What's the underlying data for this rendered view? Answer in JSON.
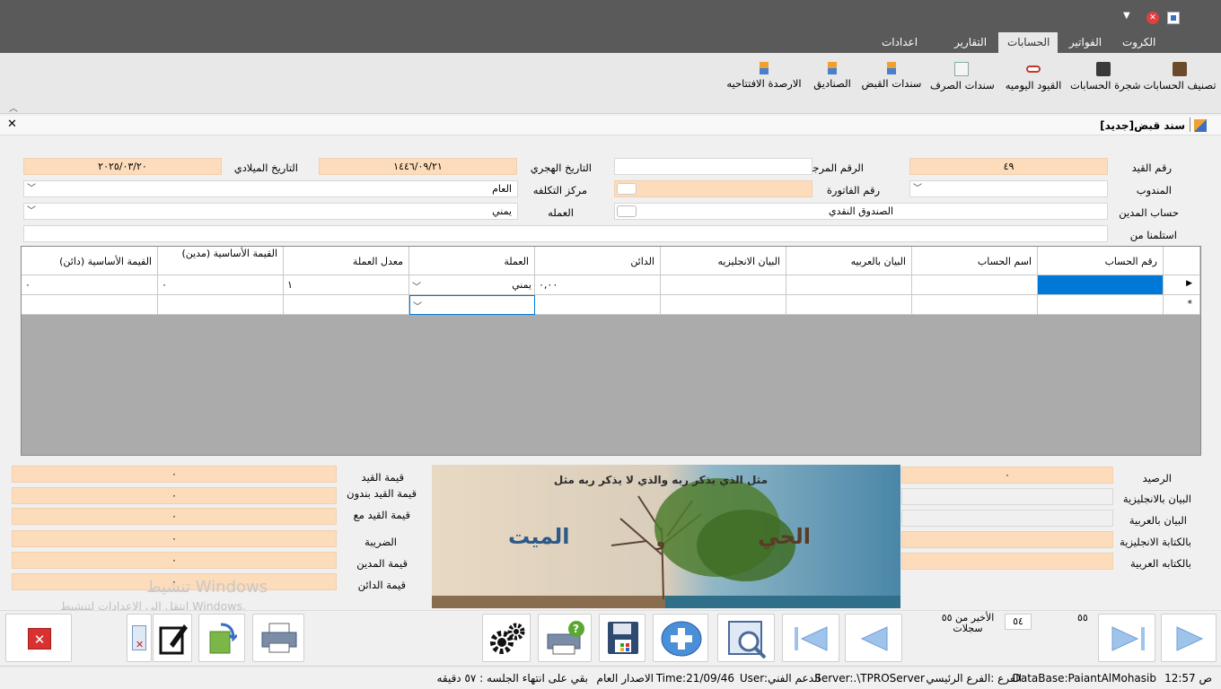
{
  "ribbon_tabs": [
    "الكروت",
    "الفواتير",
    "الحسابات",
    "التقارير",
    "اعدادات النظام"
  ],
  "ribbon_buttons": [
    "تصنيف الحسابات",
    "شجرة الحسابات",
    "القيود اليوميه",
    "سندات الصرف",
    "سندات القبض",
    "الصناديق",
    "الارصدة الافتتاحيه"
  ],
  "child_title": "سند قبض[جديد]",
  "form": {
    "entry_no_label": "رقم القيد",
    "entry_no": "٤٩",
    "ref_no_label": "الرقم المرجعي",
    "ref_no": "",
    "hijri_label": "التاريخ الهجري",
    "hijri": "١٤٤٦/٠٩/٢١",
    "greg_label": "التاريخ الميلادي",
    "greg": "٢٠٢٥/٠٣/٢٠",
    "rep_label": "المندوب",
    "rep": "",
    "invoice_label": "رقم الفاتورة",
    "invoice": "",
    "cost_center_label": "مركز التكلفه",
    "cost_center": "العام",
    "debit_acct_label": "حساب المدين",
    "debit_acct": "الصندوق النقدي",
    "currency_label": "العمله",
    "currency": "يمني",
    "received_from_label": "استلمنا من",
    "received_from": ""
  },
  "grid": {
    "headers": [
      "رقم الحساب",
      "اسم الحساب",
      "البيان بالعربيه",
      "البيان الانجليزيه",
      "الدائن",
      "العملة",
      "معدل العملة",
      "القيمة الأساسية (مدين)",
      "القيمة الأساسية (دائن)"
    ],
    "row1": {
      "credit": "٠,٠٠",
      "currency": "يمني",
      "rate": "١",
      "base_debit": "٠",
      "base_credit": "٠"
    }
  },
  "right_panel": {
    "balance_label": "الرصيد",
    "balance": "٠",
    "desc_en_label": "البيان بالانجليزية",
    "desc_ar_label": "البيان بالعربية",
    "written_en_label": "بالكتابة الانجليزية",
    "written_ar_label": "بالكتابه العربية"
  },
  "left_panel": {
    "entry_value_label": "قيمة القيد",
    "entry_value": "٠",
    "no_tax_label": "قيمة القيد بندون",
    "no_tax": "٠",
    "with_tax_label": "قيمة القيد مع",
    "with_tax": "٠",
    "tax_label": "الضريبة",
    "tax": "٠",
    "debit_value_label": "قيمة المدين",
    "debit_value": "٠",
    "credit_value_label": "قيمة الدائن",
    "credit_value": "٠"
  },
  "image": {
    "caption": "مثل الذي يذكر ربه والذي لا يذكر ربه مثل",
    "alive": "الحي",
    "and": "و",
    "dead": "الميت"
  },
  "watermark": {
    "line1": "تنشيط Windows",
    "line2": "انتقل إلى الإعدادات لتنشيط Windows."
  },
  "nav": {
    "total_label": "الأخير من ٥٥",
    "records_label": "سجلات",
    "current": "٥٤",
    "last": "٥٥"
  },
  "status": {
    "time": "ص 12:57",
    "db": "DataBase:PaiantAlMohasib",
    "branch": "الفرع :الفرع الرئيسي",
    "server": "Server:.\\TPROServer",
    "user": "User:الدعم الفني",
    "time_code": "Time:21/09/46",
    "version": "الاصدار العام",
    "session": "بقي على انتهاء الجلسه : ٥٧ دقيقه"
  }
}
